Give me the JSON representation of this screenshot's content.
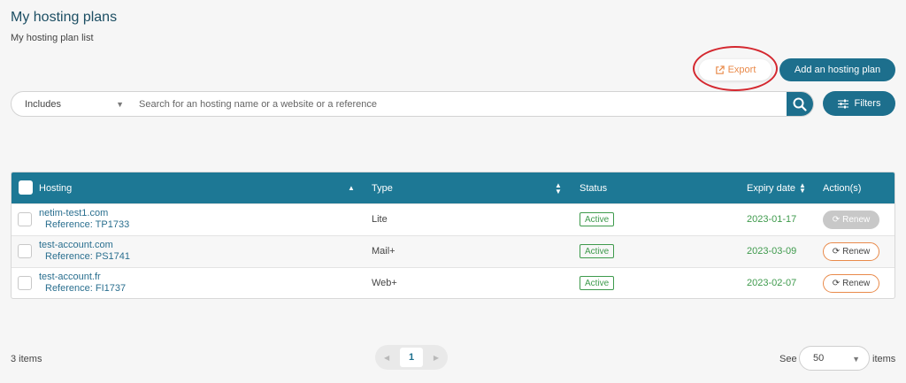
{
  "header": {
    "title": "My hosting plans",
    "subtitle": "My hosting plan list"
  },
  "toolbar": {
    "export_label": "Export",
    "add_label": "Add an hosting plan"
  },
  "search": {
    "scope_selected": "Includes",
    "placeholder": "Search for an hosting name or a website or a reference",
    "filters_label": "Filters"
  },
  "table": {
    "columns": {
      "hosting": "Hosting",
      "type": "Type",
      "status": "Status",
      "expiry": "Expiry date",
      "actions": "Action(s)"
    },
    "rows": [
      {
        "name": "netim-test1.com",
        "reference": "Reference: TP1733",
        "type": "Lite",
        "status": "Active",
        "expiry": "2023-01-17",
        "action": "Renew",
        "action_enabled": false
      },
      {
        "name": "test-account.com",
        "reference": "Reference: PS1741",
        "type": "Mail+",
        "status": "Active",
        "expiry": "2023-03-09",
        "action": "Renew",
        "action_enabled": true
      },
      {
        "name": "test-account.fr",
        "reference": "Reference: FI1737",
        "type": "Web+",
        "status": "Active",
        "expiry": "2023-02-07",
        "action": "Renew",
        "action_enabled": true
      }
    ]
  },
  "footer": {
    "items_count": "3 items",
    "current_page": "1",
    "see_label": "See",
    "per_page": "50",
    "items_label": "items"
  },
  "colors": {
    "primary": "#1d6f8d",
    "header_bg": "#1d7895",
    "active_green": "#3e9a4c",
    "accent_orange": "#e98a4a",
    "annotation_red": "#d4282f"
  },
  "icons": {
    "export": "external-link-icon",
    "search": "magnifier-icon",
    "filters": "sliders-icon",
    "renew": "refresh-icon",
    "sort": "sort-arrows-icon"
  }
}
